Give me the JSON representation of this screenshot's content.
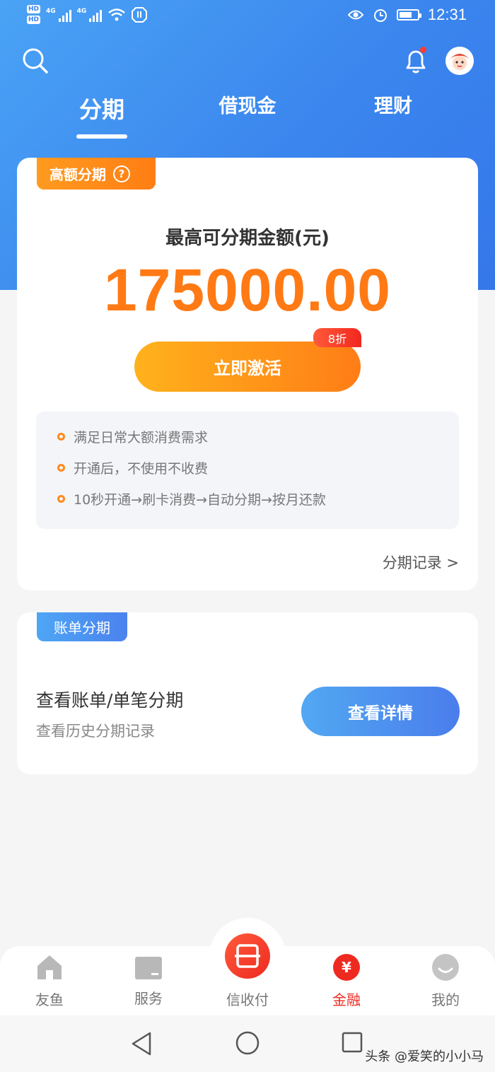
{
  "status_bar": {
    "sim1_label": "HD",
    "sim2_label": "HD",
    "network1": "4G",
    "network2": "4G",
    "time": "12:31"
  },
  "tabs": [
    {
      "label": "分期",
      "active": true
    },
    {
      "label": "借现金",
      "active": false
    },
    {
      "label": "理财",
      "active": false
    }
  ],
  "installment_card": {
    "tag": "高额分期",
    "help_glyph": "?",
    "limit_label": "最高可分期金额(元)",
    "limit_amount": "175000.00",
    "activate_button": "立即激活",
    "discount_badge": "8折",
    "benefits": [
      "满足日常大额消费需求",
      "开通后，不使用不收费",
      "10秒开通→刷卡消费→自动分期→按月还款"
    ],
    "records_link": "分期记录 >"
  },
  "bill_card": {
    "tag": "账单分期",
    "title": "查看账单/单笔分期",
    "subtitle": "查看历史分期记录",
    "detail_button": "查看详情"
  },
  "bottom_nav": [
    {
      "label": "友鱼",
      "icon": "house-icon",
      "active": false
    },
    {
      "label": "服务",
      "icon": "card-icon",
      "active": false
    },
    {
      "label": "信收付",
      "icon": "scan-icon",
      "active": false
    },
    {
      "label": "金融",
      "icon": "yen-icon",
      "active": true
    },
    {
      "label": "我的",
      "icon": "smile-icon",
      "active": false
    }
  ],
  "watermark": "头条 @爱笑的小小马",
  "colors": {
    "brand_blue": "#3b86ee",
    "accent_orange": "#ff7a14",
    "accent_red": "#ee2a20"
  }
}
